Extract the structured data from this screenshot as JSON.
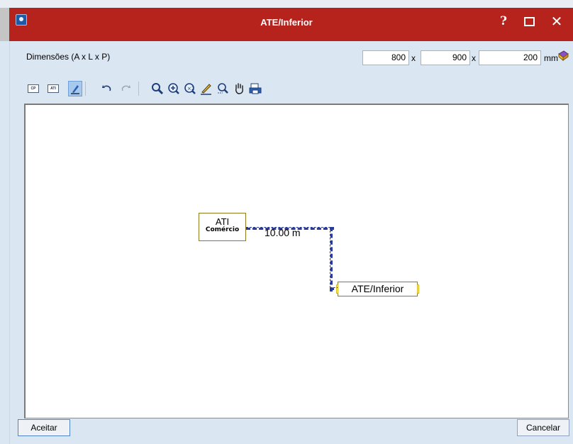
{
  "window": {
    "title": "ATE/Inferior"
  },
  "dimensions": {
    "label": "Dimensões (A x L x P)",
    "a": "800",
    "l": "900",
    "p": "200",
    "separator": "x",
    "unit": "mm"
  },
  "toolbar": {
    "items": [
      {
        "name": "cp-view-button",
        "label": "CP"
      },
      {
        "name": "ati-view-button",
        "label": "ATI"
      }
    ]
  },
  "canvas": {
    "node_ati": {
      "title": "ATI",
      "subtitle": "Comércio"
    },
    "distance": "10.00 m",
    "node_ate": {
      "label": "ATE/Inferior"
    }
  },
  "buttons": {
    "accept": "Aceitar",
    "cancel": "Cancelar"
  },
  "colors": {
    "title_bar": "#b5231c",
    "client_bg": "#dbe6f3",
    "line": "#2b3b9a",
    "node_border": "#8c7b1e"
  },
  "icons": [
    "help-icon",
    "maximize-icon",
    "close-icon",
    "book-icon",
    "undo-icon",
    "redo-icon",
    "zoom-all-icon",
    "zoom-in-icon",
    "zoom-window-icon",
    "edit-icon",
    "zoom-out-icon",
    "pan-hand-icon",
    "print-icon"
  ]
}
